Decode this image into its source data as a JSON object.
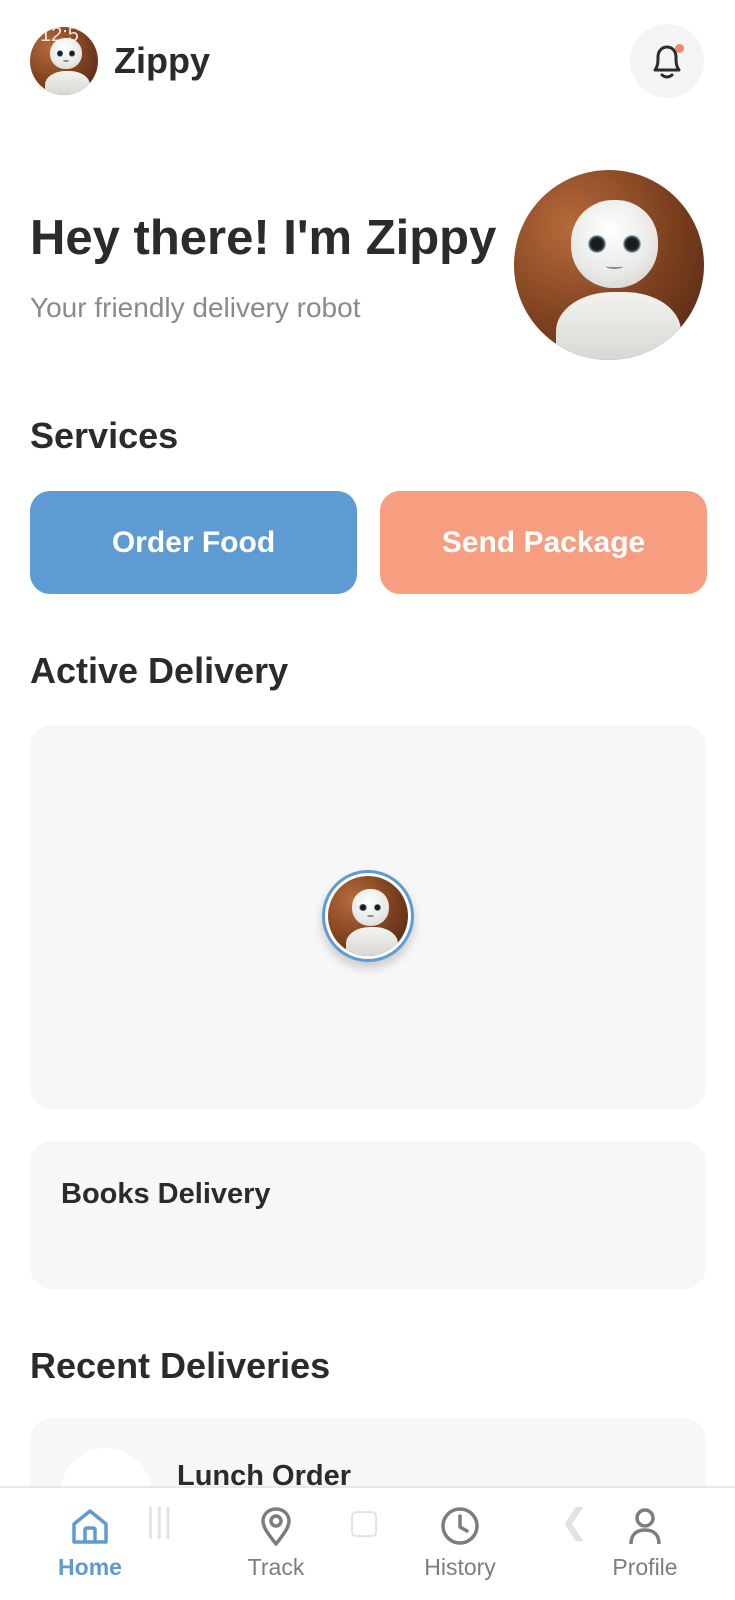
{
  "status_bar": {
    "time": "12:5"
  },
  "header": {
    "app_name": "Zippy",
    "avatar_icon": "robot-avatar",
    "notification_icon": "bell-icon",
    "notification_dot_color": "#f2886b"
  },
  "hero": {
    "title": "Hey there! I'm Zippy",
    "subtitle": "Your friendly delivery robot"
  },
  "services": {
    "section_title": "Services",
    "buttons": [
      {
        "label": "Order Food",
        "color": "#5f9bd3"
      },
      {
        "label": "Send Package",
        "color": "#f79d80"
      }
    ]
  },
  "active_delivery": {
    "section_title": "Active Delivery",
    "map_marker_icon": "robot-marker",
    "delivery_title": "Books Delivery"
  },
  "recent_deliveries": {
    "section_title": "Recent Deliveries",
    "items": [
      {
        "title": "Lunch Order",
        "icon": "package-icon"
      }
    ]
  },
  "bottom_nav": {
    "items": [
      {
        "label": "Home",
        "icon": "home-icon",
        "active": true
      },
      {
        "label": "Track",
        "icon": "location-pin-icon",
        "active": false
      },
      {
        "label": "History",
        "icon": "clock-icon",
        "active": false
      },
      {
        "label": "Profile",
        "icon": "user-icon",
        "active": false
      }
    ],
    "accent_color": "#5f9bd3"
  }
}
